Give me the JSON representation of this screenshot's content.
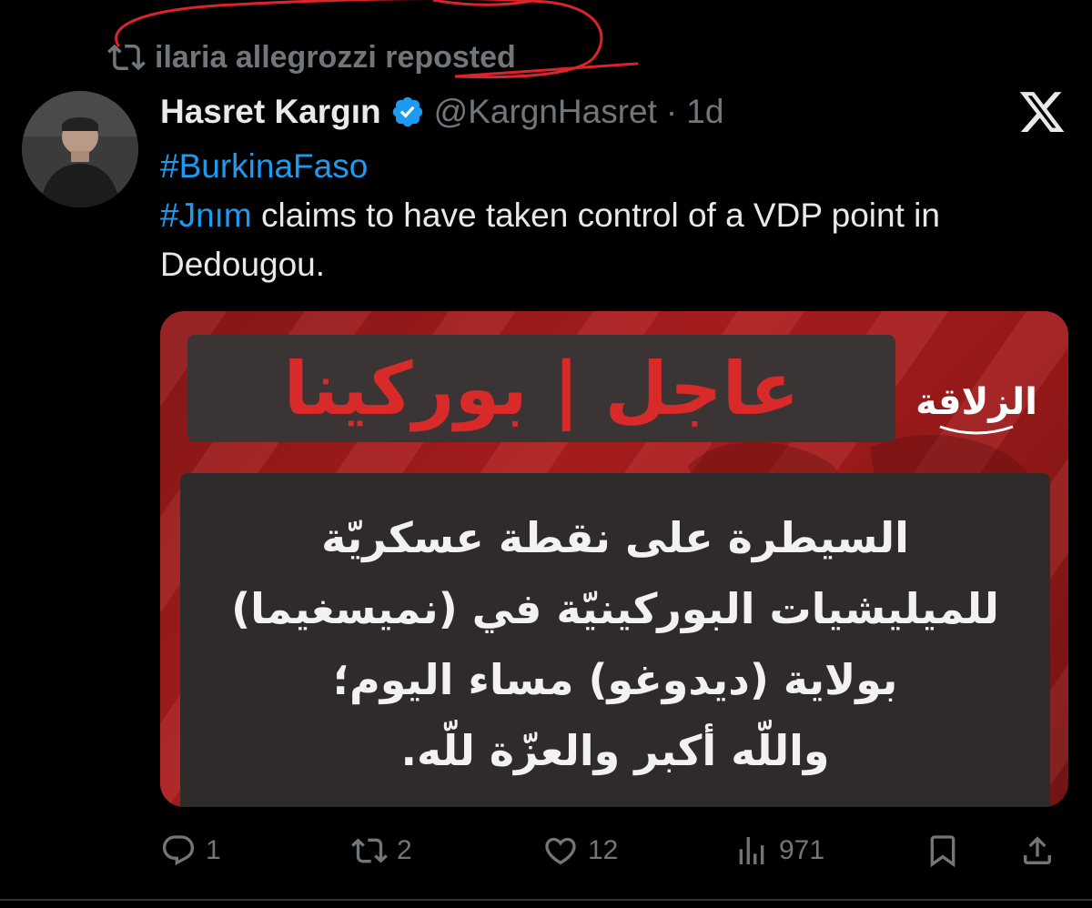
{
  "repost": {
    "label": "ilaria allegrozzi reposted",
    "icon": "repost-icon"
  },
  "tweet": {
    "author_name": "Hasret Kargın",
    "handle": "@KargnHasret",
    "separator": "·",
    "time": "1d",
    "verified": true,
    "hashtag1": "#BurkinaFaso",
    "hashtag2": "#Jnım",
    "text_rest": " claims to have taken control of a VDP point in Dedougou."
  },
  "media": {
    "headline": "عاجل | بوركينا",
    "logo_text": "الزلاقة",
    "body_lines": [
      "السيطرة على نقطة عسكريّة",
      "للميليشيات البوركينيّة في (نميسغيما)",
      "بولاية (ديدوغو) مساء اليوم؛",
      "واللّه أكبر والعزّة للّه."
    ],
    "colors": {
      "background": "#a81c1c",
      "headline": "#d92a2a",
      "panel": "#2f2b2b"
    }
  },
  "actions": {
    "replies": "1",
    "reposts": "2",
    "likes": "12",
    "views": "971"
  },
  "colors": {
    "background": "#000000",
    "text": "#e7e9ea",
    "muted": "#71767b",
    "accent": "#1d9bf0",
    "annotation": "#d8242a"
  }
}
